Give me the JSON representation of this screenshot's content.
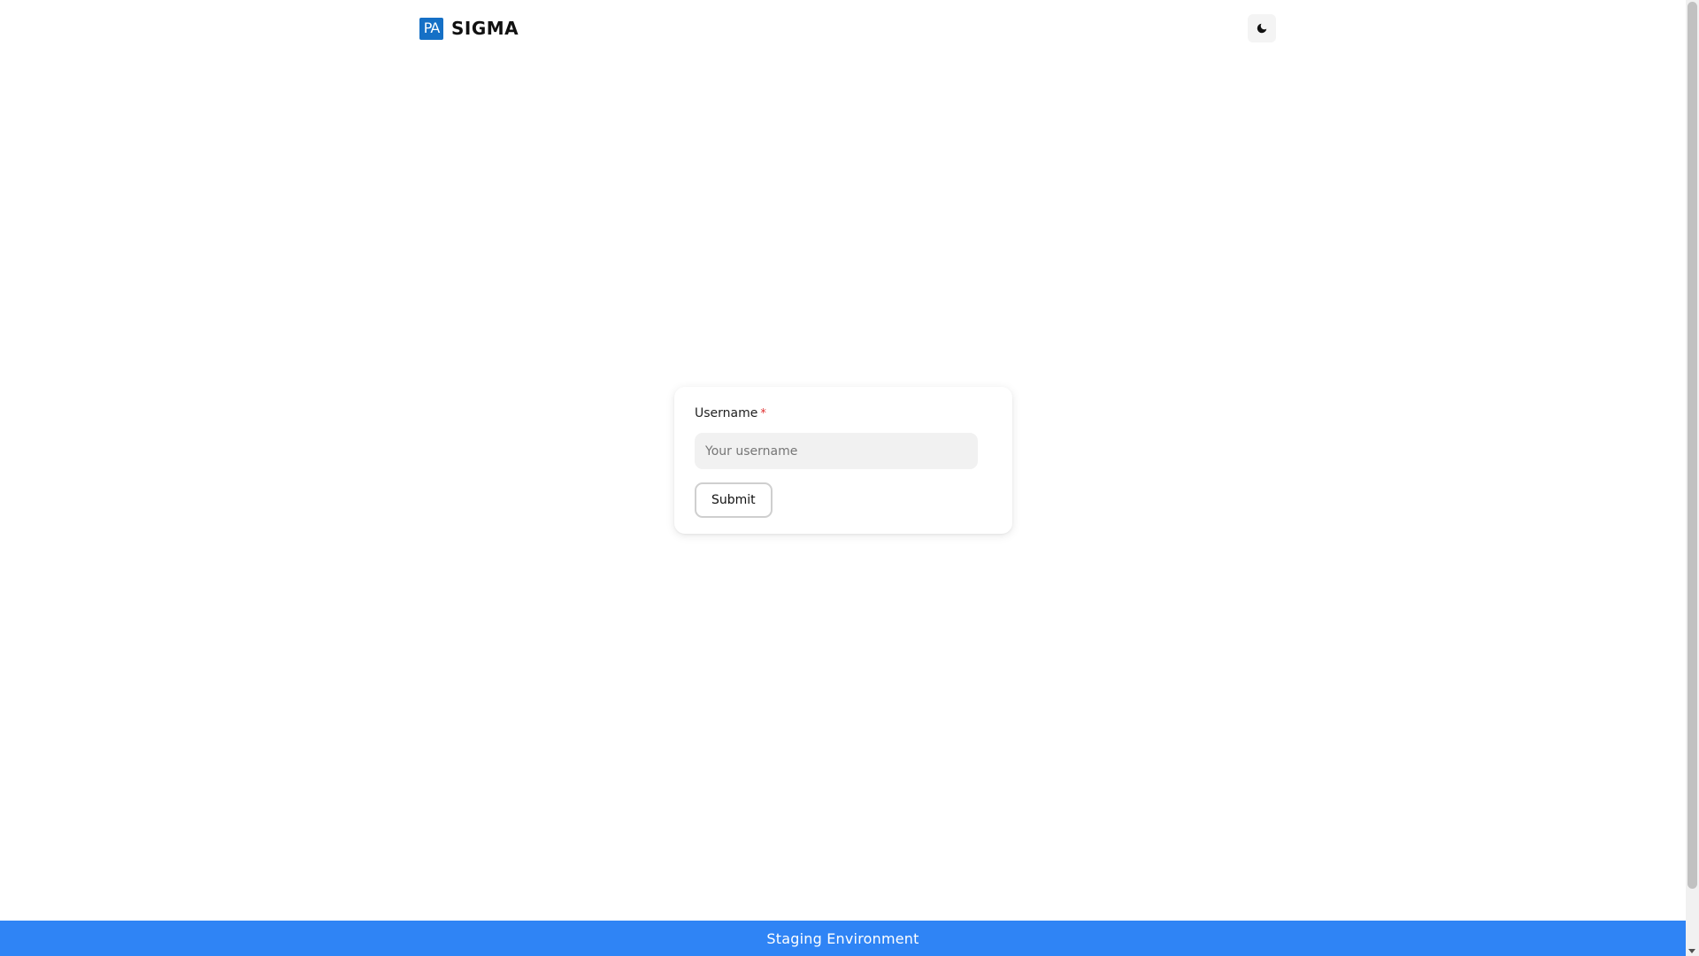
{
  "header": {
    "logo_text": "PA",
    "brand_name": "SIGMA",
    "theme_toggle_icon": "moon-icon"
  },
  "form": {
    "username_label": "Username",
    "required_marker": "*",
    "username_placeholder": "Your username",
    "username_value": "",
    "submit_label": "Submit"
  },
  "banner": {
    "text": "Staging Environment"
  },
  "colors": {
    "accent": "#1570c6",
    "banner": "#2f84f5",
    "required": "#e03131"
  }
}
